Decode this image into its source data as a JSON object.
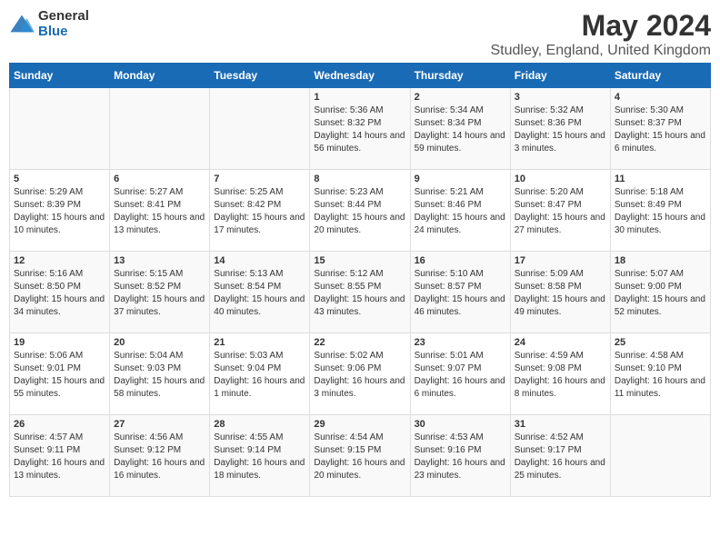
{
  "logo": {
    "general": "General",
    "blue": "Blue"
  },
  "title": "May 2024",
  "location": "Studley, England, United Kingdom",
  "days_of_week": [
    "Sunday",
    "Monday",
    "Tuesday",
    "Wednesday",
    "Thursday",
    "Friday",
    "Saturday"
  ],
  "weeks": [
    [
      {
        "day": "",
        "sunrise": "",
        "sunset": "",
        "daylight": ""
      },
      {
        "day": "",
        "sunrise": "",
        "sunset": "",
        "daylight": ""
      },
      {
        "day": "",
        "sunrise": "",
        "sunset": "",
        "daylight": ""
      },
      {
        "day": "1",
        "sunrise": "Sunrise: 5:36 AM",
        "sunset": "Sunset: 8:32 PM",
        "daylight": "Daylight: 14 hours and 56 minutes."
      },
      {
        "day": "2",
        "sunrise": "Sunrise: 5:34 AM",
        "sunset": "Sunset: 8:34 PM",
        "daylight": "Daylight: 14 hours and 59 minutes."
      },
      {
        "day": "3",
        "sunrise": "Sunrise: 5:32 AM",
        "sunset": "Sunset: 8:36 PM",
        "daylight": "Daylight: 15 hours and 3 minutes."
      },
      {
        "day": "4",
        "sunrise": "Sunrise: 5:30 AM",
        "sunset": "Sunset: 8:37 PM",
        "daylight": "Daylight: 15 hours and 6 minutes."
      }
    ],
    [
      {
        "day": "5",
        "sunrise": "Sunrise: 5:29 AM",
        "sunset": "Sunset: 8:39 PM",
        "daylight": "Daylight: 15 hours and 10 minutes."
      },
      {
        "day": "6",
        "sunrise": "Sunrise: 5:27 AM",
        "sunset": "Sunset: 8:41 PM",
        "daylight": "Daylight: 15 hours and 13 minutes."
      },
      {
        "day": "7",
        "sunrise": "Sunrise: 5:25 AM",
        "sunset": "Sunset: 8:42 PM",
        "daylight": "Daylight: 15 hours and 17 minutes."
      },
      {
        "day": "8",
        "sunrise": "Sunrise: 5:23 AM",
        "sunset": "Sunset: 8:44 PM",
        "daylight": "Daylight: 15 hours and 20 minutes."
      },
      {
        "day": "9",
        "sunrise": "Sunrise: 5:21 AM",
        "sunset": "Sunset: 8:46 PM",
        "daylight": "Daylight: 15 hours and 24 minutes."
      },
      {
        "day": "10",
        "sunrise": "Sunrise: 5:20 AM",
        "sunset": "Sunset: 8:47 PM",
        "daylight": "Daylight: 15 hours and 27 minutes."
      },
      {
        "day": "11",
        "sunrise": "Sunrise: 5:18 AM",
        "sunset": "Sunset: 8:49 PM",
        "daylight": "Daylight: 15 hours and 30 minutes."
      }
    ],
    [
      {
        "day": "12",
        "sunrise": "Sunrise: 5:16 AM",
        "sunset": "Sunset: 8:50 PM",
        "daylight": "Daylight: 15 hours and 34 minutes."
      },
      {
        "day": "13",
        "sunrise": "Sunrise: 5:15 AM",
        "sunset": "Sunset: 8:52 PM",
        "daylight": "Daylight: 15 hours and 37 minutes."
      },
      {
        "day": "14",
        "sunrise": "Sunrise: 5:13 AM",
        "sunset": "Sunset: 8:54 PM",
        "daylight": "Daylight: 15 hours and 40 minutes."
      },
      {
        "day": "15",
        "sunrise": "Sunrise: 5:12 AM",
        "sunset": "Sunset: 8:55 PM",
        "daylight": "Daylight: 15 hours and 43 minutes."
      },
      {
        "day": "16",
        "sunrise": "Sunrise: 5:10 AM",
        "sunset": "Sunset: 8:57 PM",
        "daylight": "Daylight: 15 hours and 46 minutes."
      },
      {
        "day": "17",
        "sunrise": "Sunrise: 5:09 AM",
        "sunset": "Sunset: 8:58 PM",
        "daylight": "Daylight: 15 hours and 49 minutes."
      },
      {
        "day": "18",
        "sunrise": "Sunrise: 5:07 AM",
        "sunset": "Sunset: 9:00 PM",
        "daylight": "Daylight: 15 hours and 52 minutes."
      }
    ],
    [
      {
        "day": "19",
        "sunrise": "Sunrise: 5:06 AM",
        "sunset": "Sunset: 9:01 PM",
        "daylight": "Daylight: 15 hours and 55 minutes."
      },
      {
        "day": "20",
        "sunrise": "Sunrise: 5:04 AM",
        "sunset": "Sunset: 9:03 PM",
        "daylight": "Daylight: 15 hours and 58 minutes."
      },
      {
        "day": "21",
        "sunrise": "Sunrise: 5:03 AM",
        "sunset": "Sunset: 9:04 PM",
        "daylight": "Daylight: 16 hours and 1 minute."
      },
      {
        "day": "22",
        "sunrise": "Sunrise: 5:02 AM",
        "sunset": "Sunset: 9:06 PM",
        "daylight": "Daylight: 16 hours and 3 minutes."
      },
      {
        "day": "23",
        "sunrise": "Sunrise: 5:01 AM",
        "sunset": "Sunset: 9:07 PM",
        "daylight": "Daylight: 16 hours and 6 minutes."
      },
      {
        "day": "24",
        "sunrise": "Sunrise: 4:59 AM",
        "sunset": "Sunset: 9:08 PM",
        "daylight": "Daylight: 16 hours and 8 minutes."
      },
      {
        "day": "25",
        "sunrise": "Sunrise: 4:58 AM",
        "sunset": "Sunset: 9:10 PM",
        "daylight": "Daylight: 16 hours and 11 minutes."
      }
    ],
    [
      {
        "day": "26",
        "sunrise": "Sunrise: 4:57 AM",
        "sunset": "Sunset: 9:11 PM",
        "daylight": "Daylight: 16 hours and 13 minutes."
      },
      {
        "day": "27",
        "sunrise": "Sunrise: 4:56 AM",
        "sunset": "Sunset: 9:12 PM",
        "daylight": "Daylight: 16 hours and 16 minutes."
      },
      {
        "day": "28",
        "sunrise": "Sunrise: 4:55 AM",
        "sunset": "Sunset: 9:14 PM",
        "daylight": "Daylight: 16 hours and 18 minutes."
      },
      {
        "day": "29",
        "sunrise": "Sunrise: 4:54 AM",
        "sunset": "Sunset: 9:15 PM",
        "daylight": "Daylight: 16 hours and 20 minutes."
      },
      {
        "day": "30",
        "sunrise": "Sunrise: 4:53 AM",
        "sunset": "Sunset: 9:16 PM",
        "daylight": "Daylight: 16 hours and 23 minutes."
      },
      {
        "day": "31",
        "sunrise": "Sunrise: 4:52 AM",
        "sunset": "Sunset: 9:17 PM",
        "daylight": "Daylight: 16 hours and 25 minutes."
      },
      {
        "day": "",
        "sunrise": "",
        "sunset": "",
        "daylight": ""
      }
    ]
  ]
}
